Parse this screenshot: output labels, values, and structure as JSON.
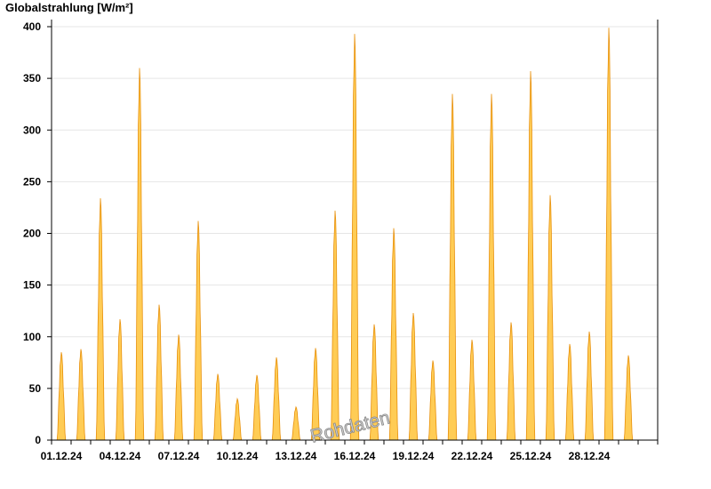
{
  "chart_data": {
    "type": "area",
    "ylabel": "Globalstrahlung [W/m²]",
    "xlabel": "",
    "title": "",
    "ylim": [
      0,
      400
    ],
    "yticks": [
      0,
      50,
      100,
      150,
      200,
      250,
      300,
      350,
      400
    ],
    "xlim_days": [
      0,
      31
    ],
    "xticks": [
      "01.12.24",
      "04.12.24",
      "07.12.24",
      "10.12.24",
      "13.12.24",
      "16.12.24",
      "19.12.24",
      "22.12.24",
      "25.12.24",
      "28.12.24"
    ],
    "grid": true,
    "legend": "none",
    "series": [
      {
        "color_fill": "#ffcc55",
        "color_line": "#e8900a",
        "daily_peaks": [
          {
            "date": "01.12.24",
            "peak": 85
          },
          {
            "date": "02.12.24",
            "peak": 88
          },
          {
            "date": "03.12.24",
            "peak": 234
          },
          {
            "date": "04.12.24",
            "peak": 117
          },
          {
            "date": "05.12.24",
            "peak": 360
          },
          {
            "date": "06.12.24",
            "peak": 131
          },
          {
            "date": "07.12.24",
            "peak": 102
          },
          {
            "date": "08.12.24",
            "peak": 212
          },
          {
            "date": "09.12.24",
            "peak": 64
          },
          {
            "date": "10.12.24",
            "peak": 40
          },
          {
            "date": "11.12.24",
            "peak": 63
          },
          {
            "date": "12.12.24",
            "peak": 80
          },
          {
            "date": "13.12.24",
            "peak": 32
          },
          {
            "date": "14.12.24",
            "peak": 89
          },
          {
            "date": "15.12.24",
            "peak": 222
          },
          {
            "date": "16.12.24",
            "peak": 393
          },
          {
            "date": "17.12.24",
            "peak": 112
          },
          {
            "date": "18.12.24",
            "peak": 205
          },
          {
            "date": "19.12.24",
            "peak": 123
          },
          {
            "date": "20.12.24",
            "peak": 77
          },
          {
            "date": "21.12.24",
            "peak": 335
          },
          {
            "date": "22.12.24",
            "peak": 97
          },
          {
            "date": "23.12.24",
            "peak": 335
          },
          {
            "date": "24.12.24",
            "peak": 114
          },
          {
            "date": "25.12.24",
            "peak": 357
          },
          {
            "date": "26.12.24",
            "peak": 237
          },
          {
            "date": "27.12.24",
            "peak": 93
          },
          {
            "date": "28.12.24",
            "peak": 105
          },
          {
            "date": "29.12.24",
            "peak": 399
          },
          {
            "date": "30.12.24",
            "peak": 82
          }
        ]
      }
    ],
    "watermark": "Rohdaten"
  }
}
